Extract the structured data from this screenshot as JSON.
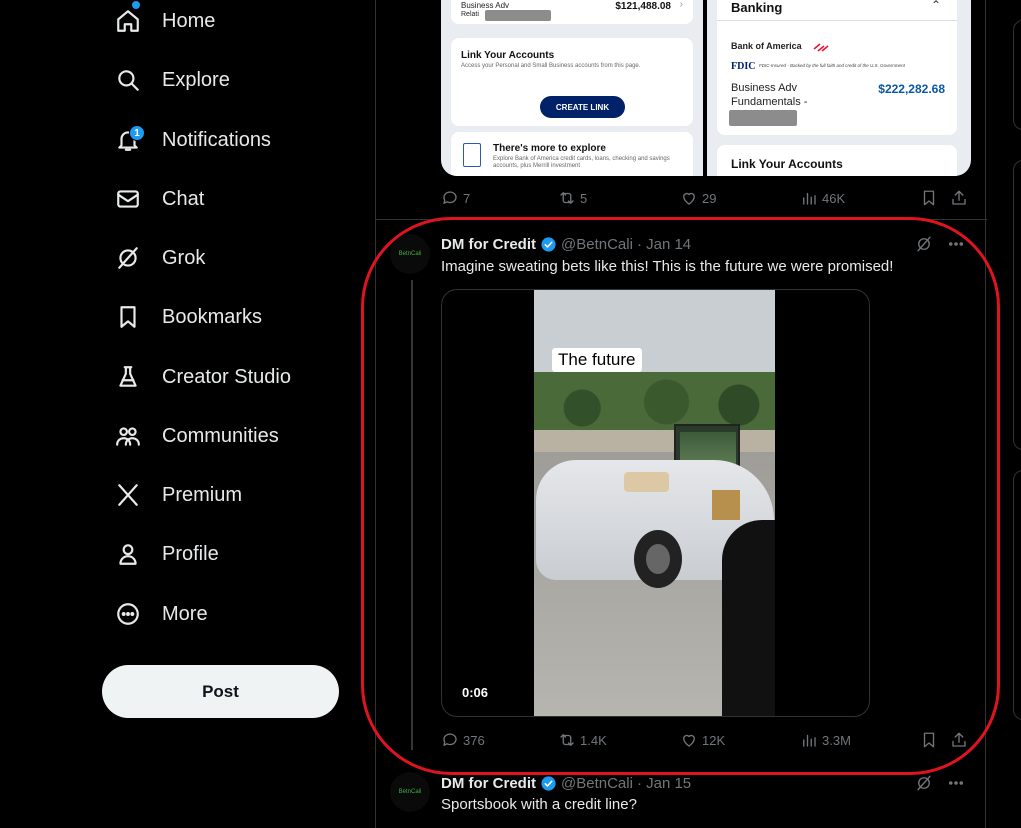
{
  "sidebar": {
    "items": [
      {
        "label": "Home",
        "icon": "home-icon"
      },
      {
        "label": "Explore",
        "icon": "search-icon"
      },
      {
        "label": "Notifications",
        "icon": "bell-icon",
        "badge": "1"
      },
      {
        "label": "Chat",
        "icon": "envelope-icon"
      },
      {
        "label": "Grok",
        "icon": "grok-icon"
      },
      {
        "label": "Bookmarks",
        "icon": "bookmark-icon"
      },
      {
        "label": "Creator Studio",
        "icon": "flask-icon"
      },
      {
        "label": "Communities",
        "icon": "people-icon"
      },
      {
        "label": "Premium",
        "icon": "x-logo-icon"
      },
      {
        "label": "Profile",
        "icon": "person-icon"
      },
      {
        "label": "More",
        "icon": "more-circle-icon"
      }
    ],
    "post_label": "Post"
  },
  "prev_tweet": {
    "left_shot": {
      "account_name": "Business Adv",
      "account_sub": "Relati",
      "amount": "$121,488.08",
      "link_title": "Link Your Accounts",
      "link_desc": "Access your Personal and Small Business accounts from this page.",
      "create_link": "CREATE LINK",
      "explore_title": "There's more to explore",
      "explore_desc": "Explore Bank of America credit cards, loans, checking and savings accounts, plus Merrill investment"
    },
    "right_shot": {
      "banking": "Banking",
      "bank_name": "Bank of America",
      "fdic": "FDIC",
      "fdic_desc": "FDIC-Insured - Backed by the full faith and credit of the U.S. Government",
      "account_name": "Business Adv",
      "account_name2": "Fundamentals -",
      "amount": "$222,282.68",
      "link_title": "Link Your Accounts"
    },
    "stats": {
      "replies": "7",
      "reposts": "5",
      "likes": "29",
      "views": "46K"
    }
  },
  "tweet": {
    "author": "DM for Credit",
    "handle": "@BetnCali",
    "date": "· Jan 14",
    "avatar_text": "BetnCali",
    "text": "Imagine sweating bets like this! This is the future we were promised!",
    "video": {
      "caption": "The future",
      "time": "0:06"
    },
    "stats": {
      "replies": "376",
      "reposts": "1.4K",
      "likes": "12K",
      "views": "3.3M"
    }
  },
  "next_tweet": {
    "author": "DM for Credit",
    "handle": "@BetnCali",
    "date": "· Jan 15",
    "avatar_text": "BetnCali",
    "text": "Sportsbook with a credit line?"
  },
  "colors": {
    "accent": "#1d9bf0",
    "highlight": "#e0141e",
    "boa_navy": "#012169"
  }
}
